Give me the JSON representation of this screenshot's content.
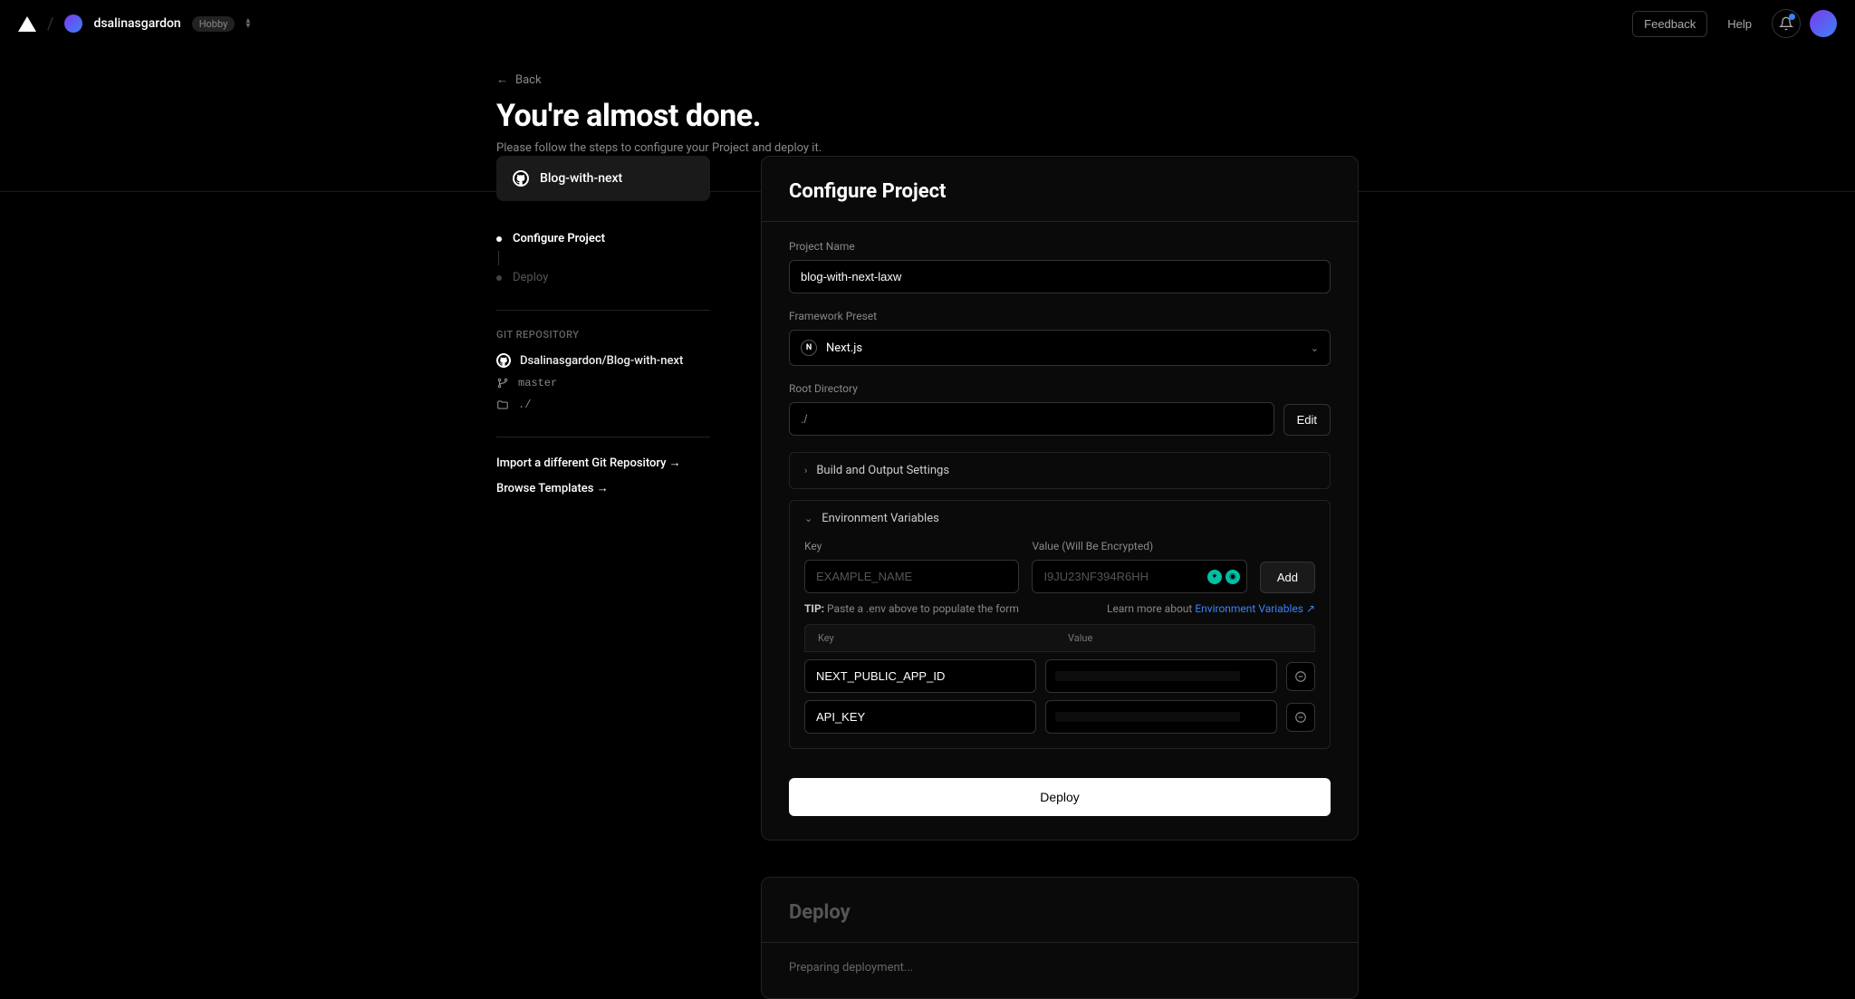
{
  "header": {
    "username": "dsalinasgardon",
    "plan_badge": "Hobby",
    "feedback": "Feedback",
    "help": "Help"
  },
  "page": {
    "back": "Back",
    "title": "You're almost done.",
    "subtitle": "Please follow the steps to configure your Project and deploy it."
  },
  "sidebar": {
    "repo_card": "Blog-with-next",
    "steps": [
      {
        "label": "Configure Project",
        "active": true
      },
      {
        "label": "Deploy",
        "active": false
      }
    ],
    "git_section_label": "GIT REPOSITORY",
    "repo_full": "Dsalinasgardon/Blog-with-next",
    "branch": "master",
    "root": "./",
    "import_link": "Import a different Git Repository →",
    "browse_link": "Browse Templates →"
  },
  "configure": {
    "title": "Configure Project",
    "project_name_label": "Project Name",
    "project_name_value": "blog-with-next-laxw",
    "framework_label": "Framework Preset",
    "framework_value": "Next.js",
    "root_label": "Root Directory",
    "root_value": "./",
    "edit_button": "Edit",
    "build_section": "Build and Output Settings",
    "env_section": "Environment Variables",
    "env_key_label": "Key",
    "env_value_label": "Value (Will Be Encrypted)",
    "env_key_placeholder": "EXAMPLE_NAME",
    "env_value_placeholder": "I9JU23NF394R6HH",
    "add_button": "Add",
    "tip_bold": "TIP:",
    "tip_text": "Paste a .env above to populate the form",
    "learn_more_prefix": "Learn more about ",
    "learn_more_link": "Environment Variables",
    "table_key": "Key",
    "table_value": "Value",
    "env_entries": [
      {
        "key": "NEXT_PUBLIC_APP_ID"
      },
      {
        "key": "API_KEY"
      }
    ],
    "deploy_button": "Deploy"
  },
  "deploy_card": {
    "title": "Deploy",
    "status": "Preparing deployment..."
  }
}
